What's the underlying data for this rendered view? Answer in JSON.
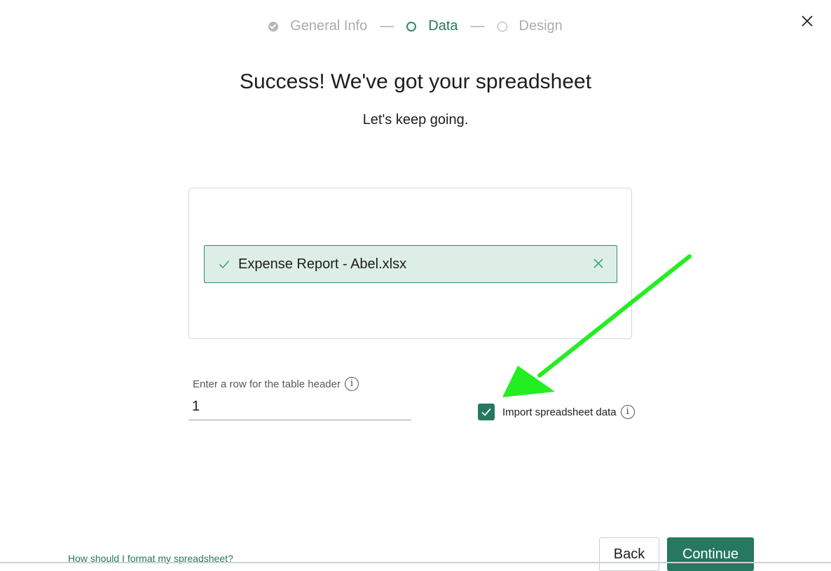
{
  "stepper": {
    "steps": [
      {
        "label": "General Info",
        "state": "completed"
      },
      {
        "label": "Data",
        "state": "active"
      },
      {
        "label": "Design",
        "state": "pending"
      }
    ],
    "separator": "—"
  },
  "close_icon": "close-icon",
  "title": "Success! We've got your spreadsheet",
  "subtitle": "Let's keep going.",
  "upload": {
    "file_name": "Expense Report - Abel.xlsx",
    "status_icon": "check-icon",
    "remove_icon": "remove-file-icon"
  },
  "header_row": {
    "label": "Enter a row for the table header",
    "value": "1",
    "info_icon": "i"
  },
  "import": {
    "label": "Import spreadsheet data",
    "checked": true,
    "info_icon": "i"
  },
  "help_link": "How should I format my spreadsheet?",
  "buttons": {
    "back": "Back",
    "continue": "Continue"
  },
  "colors": {
    "accent": "#26785f",
    "chip_bg": "#ddeee7",
    "annotation_arrow": "#22ee22"
  }
}
